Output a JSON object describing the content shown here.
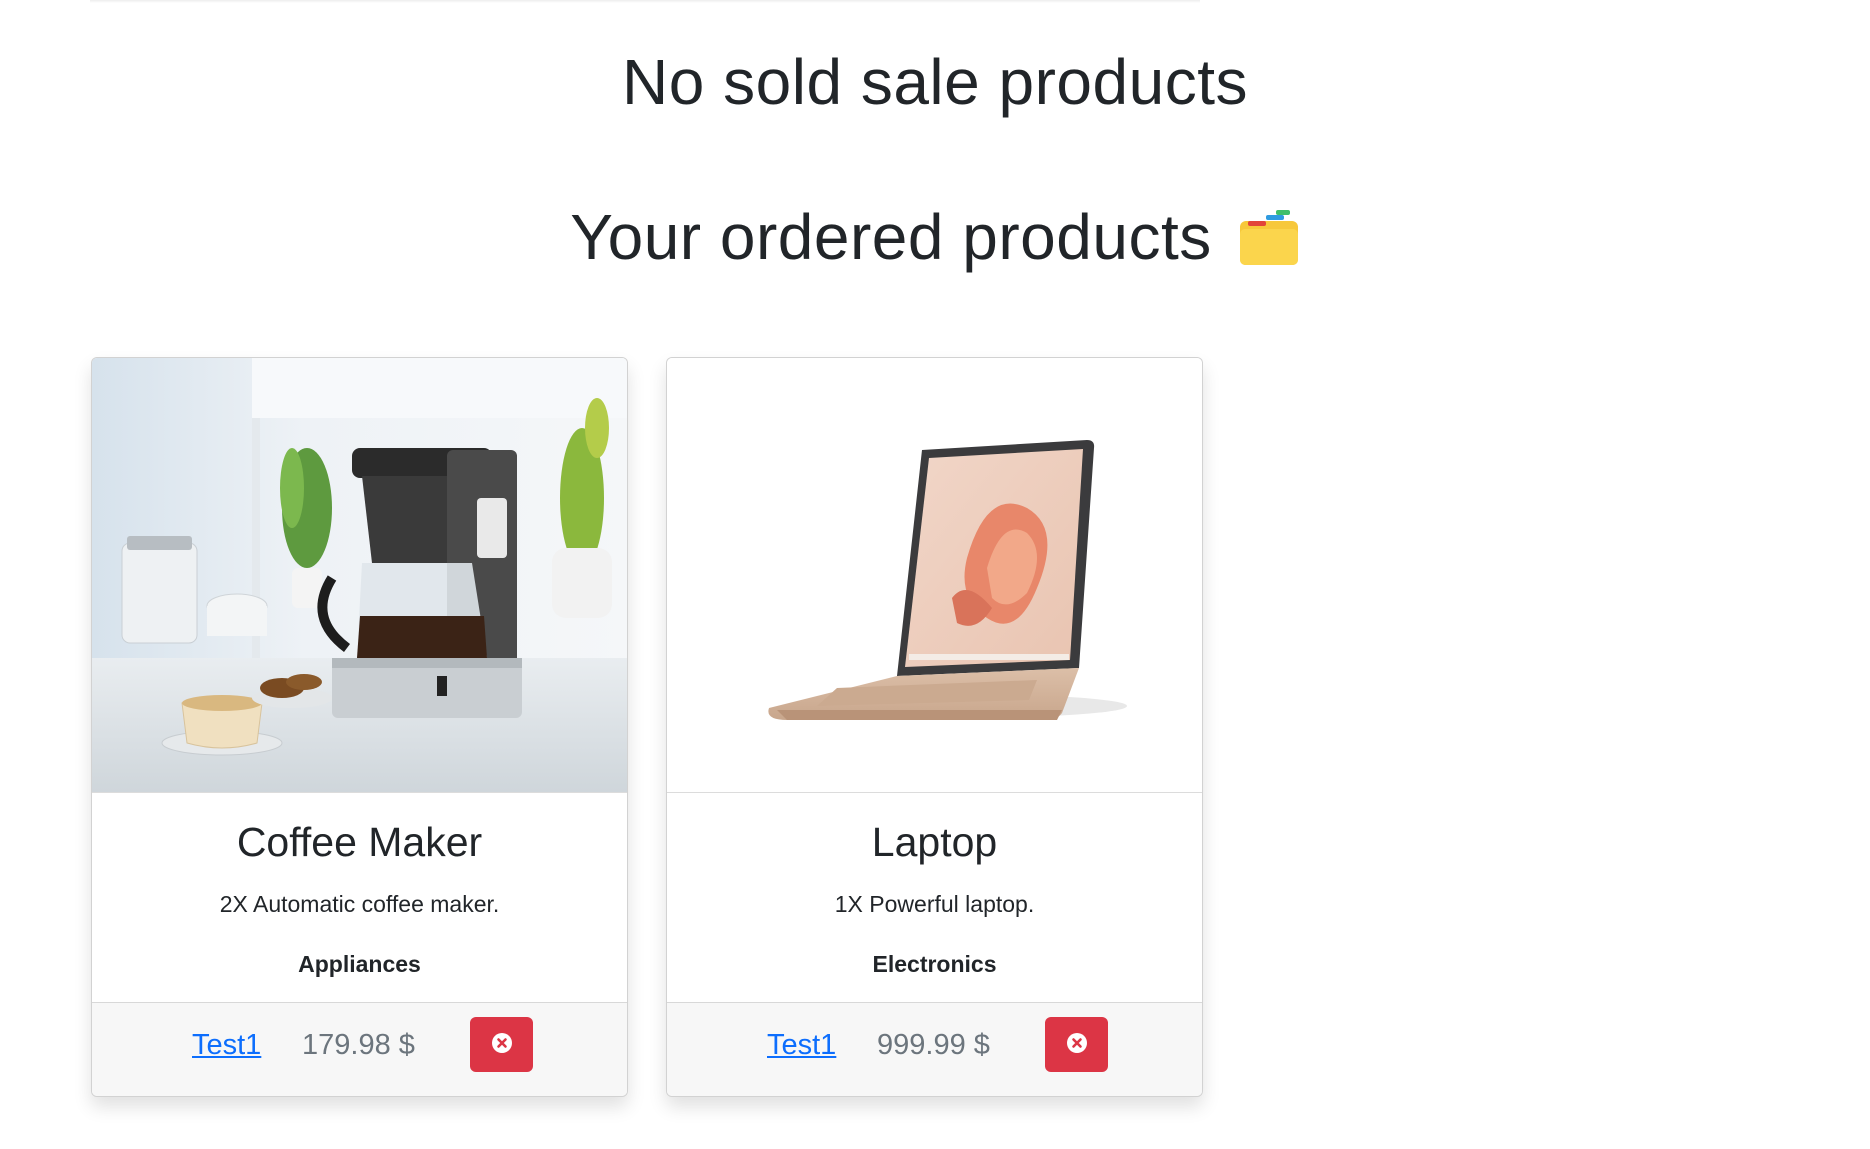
{
  "sections": {
    "sold_title": "No sold sale products",
    "ordered_title": "Your ordered products"
  },
  "icons": {
    "ordered_emoji": "card-index-dividers-icon",
    "remove": "x-circle-icon"
  },
  "colors": {
    "danger": "#dc3545",
    "link": "#0d6efd",
    "muted": "#6c757d"
  },
  "cards": [
    {
      "image": "coffee-maker-photo",
      "title": "Coffee Maker",
      "description": "2X Automatic coffee maker.",
      "category": "Appliances",
      "owner": "Test1",
      "price": "179.98 $"
    },
    {
      "image": "laptop-photo",
      "title": "Laptop",
      "description": "1X Powerful laptop.",
      "category": "Electronics",
      "owner": "Test1",
      "price": "999.99 $"
    }
  ]
}
